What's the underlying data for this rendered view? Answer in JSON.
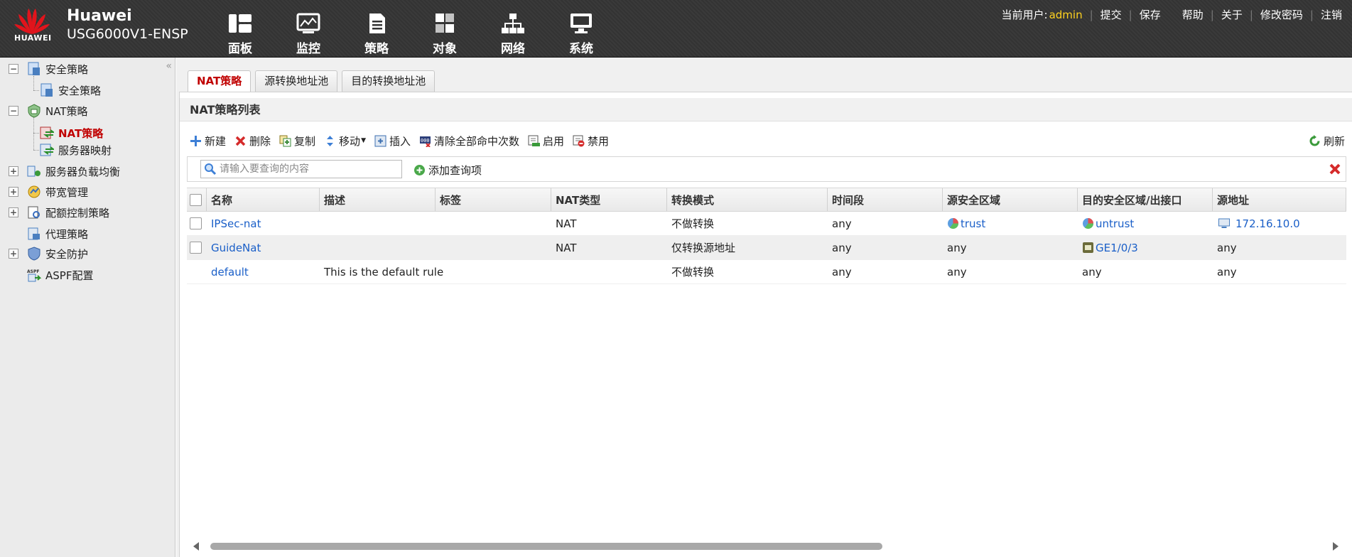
{
  "header": {
    "logo_text": "HUAWEI",
    "brand": "Huawei",
    "product": "USG6000V1-ENSP",
    "nav": [
      {
        "label": "面板",
        "icon": "dashboard-icon"
      },
      {
        "label": "监控",
        "icon": "monitor-icon"
      },
      {
        "label": "策略",
        "icon": "policy-icon"
      },
      {
        "label": "对象",
        "icon": "object-icon"
      },
      {
        "label": "网络",
        "icon": "network-icon"
      },
      {
        "label": "系统",
        "icon": "system-icon"
      }
    ],
    "current_user_label": "当前用户:",
    "current_user": "admin",
    "links": {
      "submit": "提交",
      "save": "保存",
      "help": "帮助",
      "about": "关于",
      "change_password": "修改密码",
      "logout": "注销"
    }
  },
  "sidebar": {
    "items": [
      {
        "label": "安全策略",
        "expander": "−"
      },
      {
        "label": "安全策略"
      },
      {
        "label": "NAT策略",
        "expander": "−"
      },
      {
        "label": "NAT策略",
        "active": true
      },
      {
        "label": "服务器映射"
      },
      {
        "label": "服务器负载均衡",
        "expander": "+"
      },
      {
        "label": "带宽管理",
        "expander": "+"
      },
      {
        "label": "配额控制策略",
        "expander": "+"
      },
      {
        "label": "代理策略"
      },
      {
        "label": "安全防护",
        "expander": "+"
      },
      {
        "label": "ASPF配置"
      }
    ]
  },
  "tabs": [
    "NAT策略",
    "源转换地址池",
    "目的转换地址池"
  ],
  "panel": {
    "title": "NAT策略列表",
    "toolbar": {
      "new": "新建",
      "delete": "删除",
      "copy": "复制",
      "move": "移动",
      "insert": "插入",
      "clear_hits": "清除全部命中次数",
      "enable": "启用",
      "disable": "禁用"
    },
    "refresh": "刷新",
    "search_placeholder": "请输入要查询的内容",
    "add_query": "添加查询项"
  },
  "table": {
    "columns": {
      "name": "名称",
      "desc": "描述",
      "tag": "标签",
      "nat_type": "NAT类型",
      "mode": "转换模式",
      "time": "时间段",
      "src_zone": "源安全区域",
      "dst_zone": "目的安全区域/出接口",
      "src_addr": "源地址"
    },
    "rows": [
      {
        "name": "IPSec-nat",
        "desc": "",
        "tag": "",
        "nat_type": "NAT",
        "mode": "不做转换",
        "time": "any",
        "src_zone": "trust",
        "dst_zone": "untrust",
        "src_addr": "172.16.10.0"
      },
      {
        "name": "GuideNat",
        "desc": "",
        "tag": "",
        "nat_type": "NAT",
        "mode": "仅转换源地址",
        "time": "any",
        "src_zone": "any",
        "dst_zone": "GE1/0/3",
        "src_addr": "any"
      },
      {
        "name": "default",
        "desc": "This is the default rule",
        "tag": "",
        "nat_type": "",
        "mode": "不做转换",
        "time": "any",
        "src_zone": "any",
        "dst_zone": "any",
        "src_addr": "any"
      }
    ]
  },
  "colors": {
    "accent_red": "#c00000",
    "link_blue": "#1a5fc8",
    "user_yellow": "#ffd21f"
  }
}
